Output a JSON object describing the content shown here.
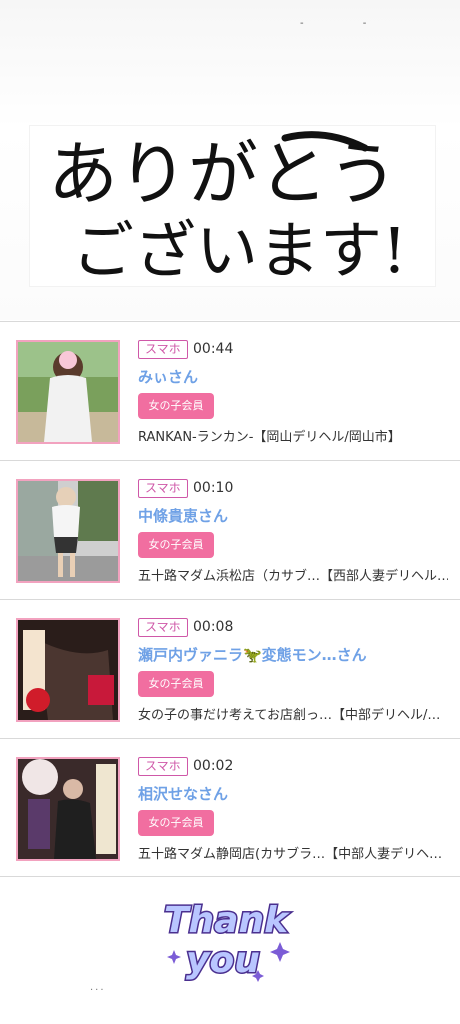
{
  "banner": {
    "line1": "ありがとう",
    "line2": "ございます!"
  },
  "history": [
    {
      "device": "スマホ",
      "time": "00:44",
      "name": "みぃさん",
      "member": "女の子会員",
      "shop": "RANKAN-ランカン-【岡山デリヘル/岡山市】"
    },
    {
      "device": "スマホ",
      "time": "00:10",
      "name": "中條貴恵さん",
      "member": "女の子会員",
      "shop": "五十路マダム浜松店（カサブ…【西部人妻デリヘル…"
    },
    {
      "device": "スマホ",
      "time": "00:08",
      "name": "瀬戸内ヴァニラ🦖変態モン…さん",
      "member": "女の子会員",
      "shop": "女の子の事だけ考えてお店創っ…【中部デリヘル/…"
    },
    {
      "device": "スマホ",
      "time": "00:02",
      "name": "相沢せなさん",
      "member": "女の子会員",
      "shop": "五十路マダム静岡店(カサブラ…【中部人妻デリヘ…"
    }
  ],
  "footer": {
    "sticker_line1": "Thank",
    "sticker_line2": "you",
    "dots": "..."
  },
  "colors": {
    "accent_pink": "#f16ea0",
    "badge_border": "#cf58a8",
    "name_blue": "#6fa1e6"
  }
}
